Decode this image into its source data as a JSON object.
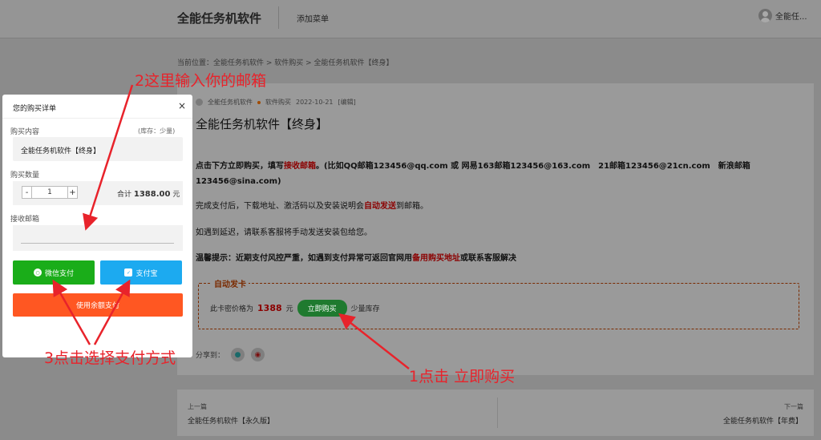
{
  "header": {
    "brand": "全能任务机软件",
    "nav_add_menu": "添加菜单",
    "user_name": "全能任..."
  },
  "breadcrumb": "当前位置：全能任务机软件 > 软件购买 > 全能任务机软件【终身】",
  "article": {
    "meta_author": "全能任务机软件",
    "meta_category": "软件购买",
    "meta_date": "2022-10-21",
    "meta_edit": "[编辑]",
    "title": "全能任务机软件【终身】",
    "p1_a": "点击下方立即购买，填写",
    "p1_red": "接收邮箱",
    "p1_b": "。(比如QQ邮箱123456@qq.com 或 网易163邮箱123456@163.com　21邮箱123456@21cn.com　新浪邮箱123456@sina.com)",
    "p2_a": "完成支付后，下载地址、激活码以及安装说明会",
    "p2_red": "自动发送",
    "p2_b": "到邮箱。",
    "p3": "如遇到延迟，请联系客服将手动发送安装包给您。",
    "p4_a": "温馨提示：近期支付风控严重，如遇到支付异常可返回官网用",
    "p4_red": "备用购买地址",
    "p4_b": "或联系客服解决",
    "auto_label": "自动发卡",
    "price_prefix": "此卡密价格为",
    "price": "1388",
    "price_unit": "元",
    "buy_button": "立即购买",
    "stock_text": "少量库存",
    "share_label": "分享到："
  },
  "prevnext": {
    "prev_label": "上一篇",
    "prev_title": "全能任务机软件【永久版】",
    "next_label": "下一篇",
    "next_title": "全能任务机软件【年费】"
  },
  "modal": {
    "title": "您的购买详单",
    "close": "×",
    "content_label": "购买内容",
    "stock": "(库存：少量)",
    "product": "全能任务机软件【终身】",
    "qty_label": "购买数量",
    "qty_minus": "-",
    "qty_value": "1",
    "qty_plus": "+",
    "total_prefix": "合计",
    "total_amount": "1388.00",
    "total_unit": "元",
    "email_label": "接收邮箱",
    "email_value": "",
    "wechat_pay": "微信支付",
    "alipay": "支付宝",
    "balance_pay": "使用余额支付"
  },
  "annotations": {
    "step2": "2这里输入你的邮箱",
    "step3": "3点击选择支付方式",
    "step1": "1点击 立即购买"
  }
}
